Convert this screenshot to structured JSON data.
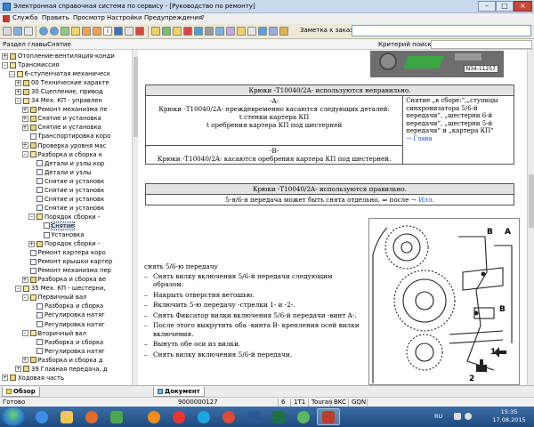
{
  "window": {
    "title": "Электронная справочная система по сервису - [Руководство по ремонту]",
    "buttons": [
      "–",
      "□",
      "×"
    ]
  },
  "menu": [
    "Служба",
    "Править",
    "Просмотр",
    "Настройки",
    "Предупреждения",
    "?"
  ],
  "toolbar": {
    "order_label": "Заметка к заказу:",
    "order_value": "",
    "icons": [
      "open-icon",
      "save-icon",
      "print-icon",
      "back-icon",
      "forward-icon",
      "home-icon",
      "info-icon",
      "search-icon",
      "find-icon",
      "note-icon",
      "up-icon",
      "down-icon",
      "bookmark-icon",
      "list-icon",
      "tools-icon",
      "help-icon",
      "stop-icon",
      "refresh-icon",
      "camera-icon",
      "settings-icon",
      "tree-icon",
      "table-icon",
      "export-icon",
      "mail-icon"
    ]
  },
  "section": {
    "title": "Раздел главыСнятие",
    "criteria_label": "Критерий поиска:",
    "criteria_value": ""
  },
  "tree": [
    {
      "label": "Отопление-вентиляция-конди",
      "level": 0,
      "toggle": "+",
      "icon": "folder"
    },
    {
      "label": "Трансмиссия",
      "level": 0,
      "toggle": "–",
      "icon": "folder-open"
    },
    {
      "label": "6-ступенчатая механическ",
      "level": 1,
      "toggle": "–",
      "icon": "folder-open"
    },
    {
      "label": "00 Технические характе",
      "level": 2,
      "toggle": "+",
      "icon": "folder"
    },
    {
      "label": "30 Сцепление, привод",
      "level": 2,
      "toggle": "+",
      "icon": "folder"
    },
    {
      "label": "34 Мех. КП - управлен",
      "level": 2,
      "toggle": "–",
      "icon": "folder-open"
    },
    {
      "label": "Ремонт механизма пе",
      "level": 3,
      "toggle": "+",
      "icon": "folder"
    },
    {
      "label": "Снятие и установка",
      "level": 3,
      "toggle": "+",
      "icon": "folder"
    },
    {
      "label": "Снятие и установка",
      "level": 3,
      "toggle": "+",
      "icon": "folder"
    },
    {
      "label": "Транспортировка коро",
      "level": 3,
      "toggle": "",
      "icon": "doc"
    },
    {
      "label": "Проверка уровня мас",
      "level": 3,
      "toggle": "+",
      "icon": "folder"
    },
    {
      "label": "Разборка и сборка к",
      "level": 3,
      "toggle": "–",
      "icon": "folder-open"
    },
    {
      "label": "Детали и узлы кор",
      "level": 4,
      "toggle": "",
      "icon": "doc"
    },
    {
      "label": "Детали и узлы",
      "level": 4,
      "toggle": "",
      "icon": "doc"
    },
    {
      "label": "Снятие и установк",
      "level": 4,
      "toggle": "",
      "icon": "doc"
    },
    {
      "label": "Снятие и установк",
      "level": 4,
      "toggle": "",
      "icon": "doc"
    },
    {
      "label": "Снятие и установк",
      "level": 4,
      "toggle": "",
      "icon": "doc"
    },
    {
      "label": "Снятие и установк",
      "level": 4,
      "toggle": "",
      "icon": "doc"
    },
    {
      "label": "Порядок сборки -",
      "level": 4,
      "toggle": "–",
      "icon": "folder-open"
    },
    {
      "label": "Снятие",
      "level": 5,
      "toggle": "",
      "icon": "doc",
      "selected": true
    },
    {
      "label": "Установка",
      "level": 5,
      "toggle": "",
      "icon": "doc"
    },
    {
      "label": "Порядок сборки -",
      "level": 4,
      "toggle": "+",
      "icon": "folder"
    },
    {
      "label": "Ремонт картера коро",
      "level": 3,
      "toggle": "",
      "icon": "doc"
    },
    {
      "label": "Ремонт крышки картер",
      "level": 3,
      "toggle": "",
      "icon": "doc"
    },
    {
      "label": "Ремонт механизма пер",
      "level": 3,
      "toggle": "",
      "icon": "doc"
    },
    {
      "label": "Разборка и сборка ве",
      "level": 3,
      "toggle": "+",
      "icon": "folder"
    },
    {
      "label": "35 Мех. КП - шестерни,",
      "level": 2,
      "toggle": "–",
      "icon": "folder-open"
    },
    {
      "label": "Первичный вал",
      "level": 3,
      "toggle": "–",
      "icon": "folder-open"
    },
    {
      "label": "Разборка и сборка",
      "level": 4,
      "toggle": "",
      "icon": "doc"
    },
    {
      "label": "Регулировка натяг",
      "level": 4,
      "toggle": "",
      "icon": "doc"
    },
    {
      "label": "Регулировка натяг",
      "level": 4,
      "toggle": "",
      "icon": "doc"
    },
    {
      "label": "Вторичный вал",
      "level": 3,
      "toggle": "–",
      "icon": "folder-open"
    },
    {
      "label": "Разборка и сборка",
      "level": 4,
      "toggle": "",
      "icon": "doc"
    },
    {
      "label": "Регулировка натяг",
      "level": 4,
      "toggle": "",
      "icon": "doc"
    },
    {
      "label": "Разборка и сборка д",
      "level": 3,
      "toggle": "+",
      "icon": "folder"
    },
    {
      "label": "39 Главная передача, д",
      "level": 2,
      "toggle": "+",
      "icon": "folder"
    },
    {
      "label": "Ходовая часть",
      "level": 0,
      "toggle": "+",
      "icon": "folder"
    }
  ],
  "figure_top": {
    "label": "N34-11257"
  },
  "table1": {
    "header": "Крюки -T10040/2A- используются неправильно.",
    "a_label": "-A-",
    "a_text1": "Крюки -T10040/2A- преждевременно касаются следующих деталей:",
    "a_item1": "t  стенки картера КП",
    "a_item2": "t  оребрения картера КП под шестерней",
    "b_label": "-B-",
    "b_text": "Крюки -T10040/2A- касаются оребрения картера КП под шестерней.",
    "side_text": "Снятие „в сборе:“,„ступицы синхронизатора 5/6-й передачи“, „шестерни 6-й передачи“, „шестерни 5-й передачи“ и „картера КП“",
    "side_link": "→ Глава"
  },
  "table2": {
    "header": "Крюки -T10040/2A- используются правильно.",
    "text": "5-я/6-я передача может быть снята отдельно, ⇒ после",
    "link": "→ Илл."
  },
  "content": {
    "heading": "снять 5/6-ю передачу",
    "steps": [
      "Снять вилку включения 5/6-й передачи следующим образом:",
      "Накрыть отверстия ветошью.",
      "Включить 5-ю передачу -стрелки 1- и -2-.",
      "Снять Фиксатор вилки включения 5/6-й передачи -винт A-.",
      "После этого выкрутить оба -винта B- крепления осей вилки включения.",
      "Вынуть обе оси из вилки.",
      "Снять вилку включения 5/6-й передачи."
    ]
  },
  "diagram": {
    "labels": [
      "B",
      "A",
      "1",
      "B",
      "2"
    ]
  },
  "tabs": {
    "left": "Обзор",
    "doc": "Документ"
  },
  "status": {
    "ready": "Готово",
    "code": "9000000127",
    "num": "6",
    "engine": "1T1",
    "model": "Touran",
    "code2": "BKC",
    "code3": "GQN"
  },
  "taskbar": {
    "lang": "RU",
    "time": "15:35",
    "date": "17.08.2015"
  }
}
